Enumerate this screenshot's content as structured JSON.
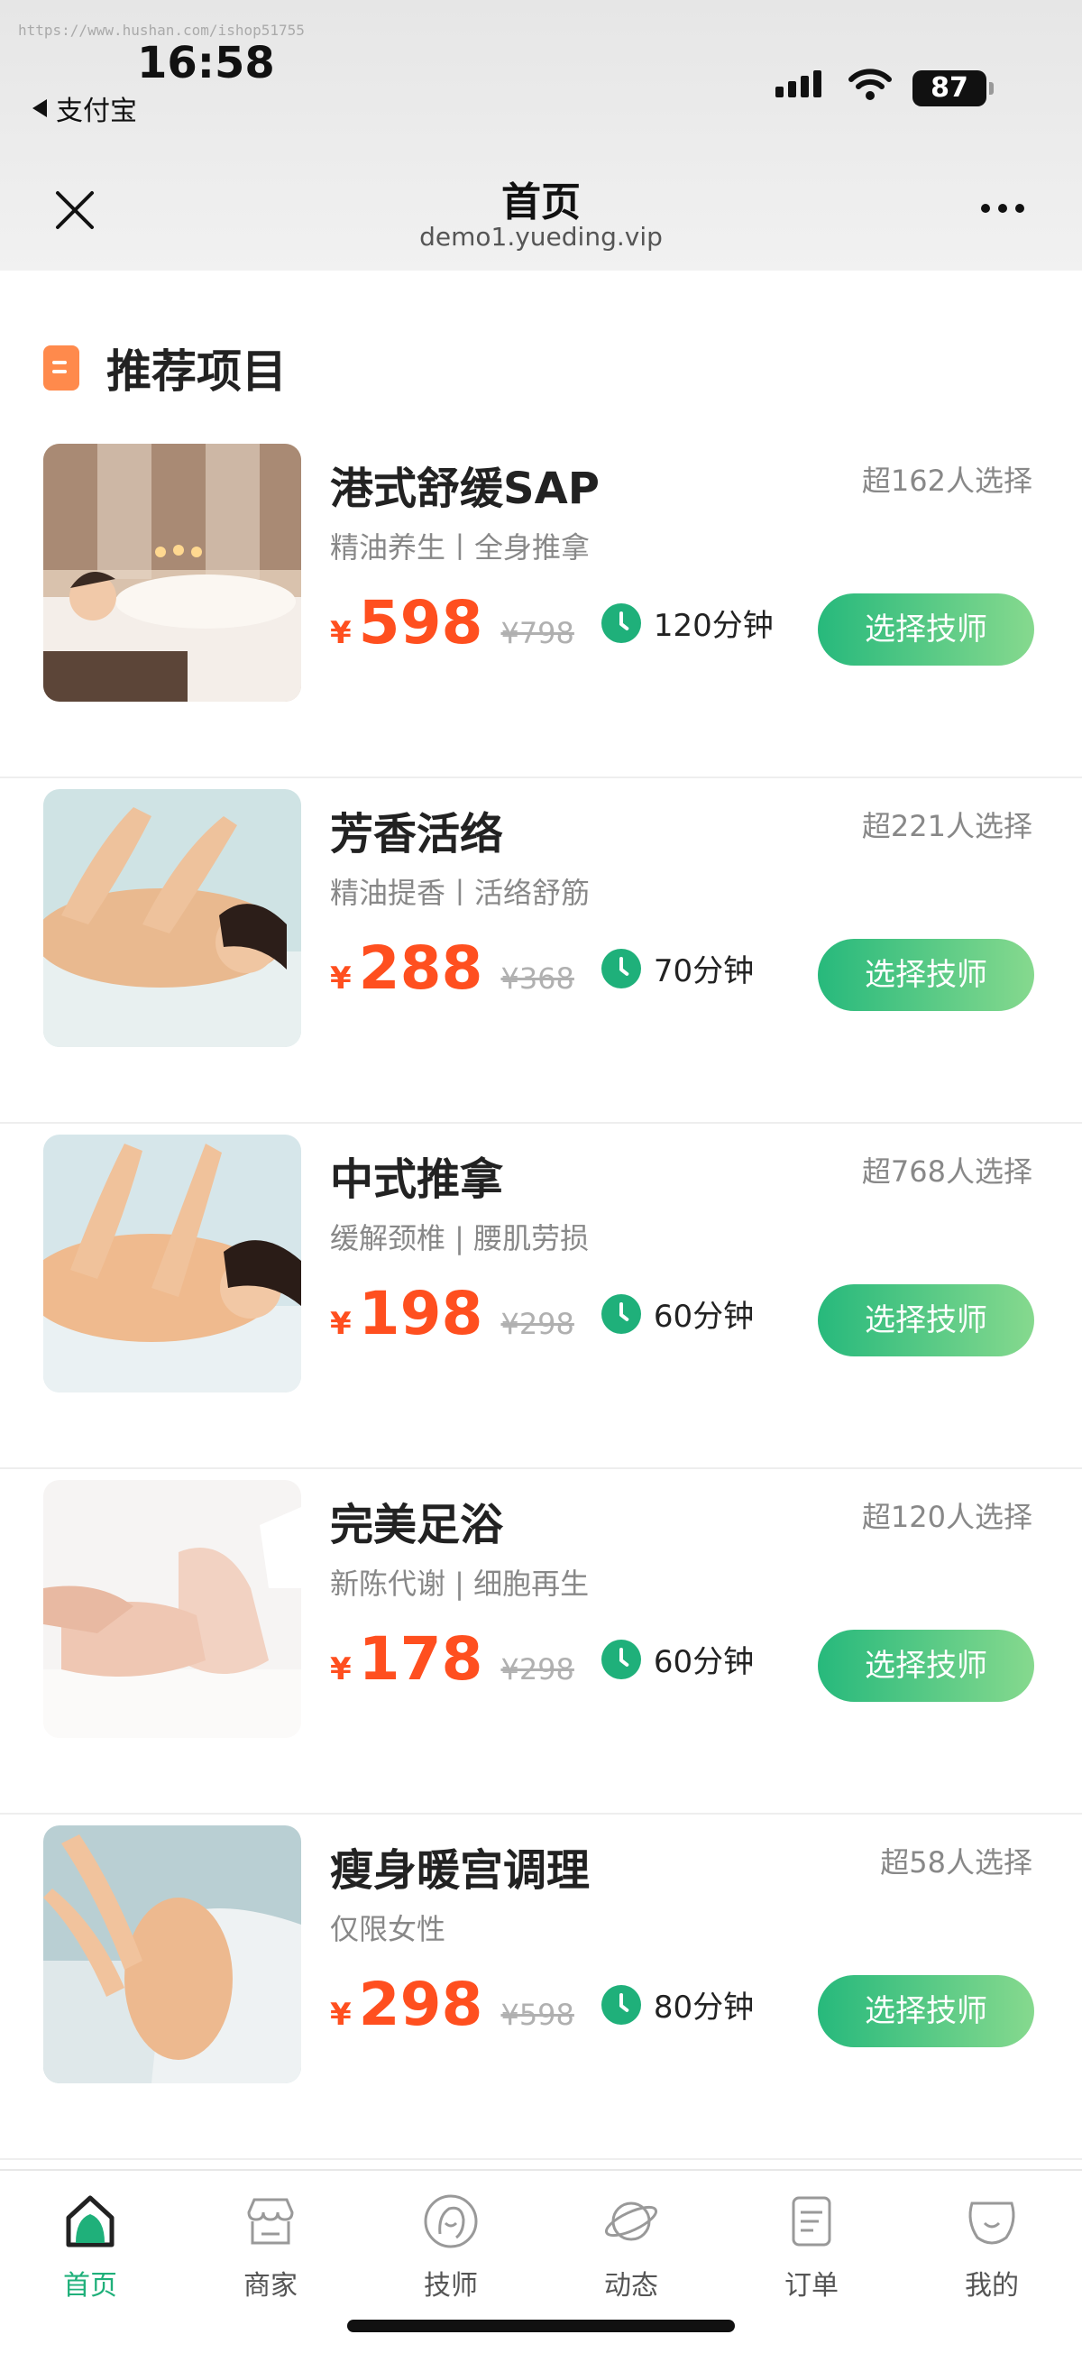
{
  "watermark": "https://www.hushan.com/ishop51755",
  "status_bar": {
    "time": "16:58",
    "back_app": "支付宝",
    "battery": "87"
  },
  "nav": {
    "title": "首页",
    "subtitle": "demo1.yueding.vip"
  },
  "section": {
    "title": "推荐项目"
  },
  "colors": {
    "accent_green": "#1fb07a",
    "price_orange": "#ff4f1f",
    "section_icon": "#ff8a4c"
  },
  "items": [
    {
      "name": "港式舒缓SAP",
      "sold": "超162人选择",
      "tags": "精油养生丨全身推拿",
      "currency": "¥",
      "price": "598",
      "original": "¥798",
      "duration": "120分钟",
      "button": "选择技师"
    },
    {
      "name": "芳香活络",
      "sold": "超221人选择",
      "tags": "精油提香丨活络舒筋",
      "currency": "¥",
      "price": "288",
      "original": "¥368",
      "duration": "70分钟",
      "button": "选择技师"
    },
    {
      "name": "中式推拿",
      "sold": "超768人选择",
      "tags": "缓解颈椎 | 腰肌劳损",
      "currency": "¥",
      "price": "198",
      "original": "¥298",
      "duration": "60分钟",
      "button": "选择技师"
    },
    {
      "name": "完美足浴",
      "sold": "超120人选择",
      "tags": "新陈代谢 | 细胞再生",
      "currency": "¥",
      "price": "178",
      "original": "¥298",
      "duration": "60分钟",
      "button": "选择技师"
    },
    {
      "name": "瘦身暖宫调理",
      "sold": "超58人选择",
      "tags": "仅限女性",
      "currency": "¥",
      "price": "298",
      "original": "¥598",
      "duration": "80分钟",
      "button": "选择技师"
    }
  ],
  "tabbar": [
    {
      "label": "首页",
      "icon": "home-icon"
    },
    {
      "label": "商家",
      "icon": "store-icon"
    },
    {
      "label": "技师",
      "icon": "technician-icon"
    },
    {
      "label": "动态",
      "icon": "planet-icon"
    },
    {
      "label": "订单",
      "icon": "order-icon"
    },
    {
      "label": "我的",
      "icon": "profile-icon"
    }
  ]
}
